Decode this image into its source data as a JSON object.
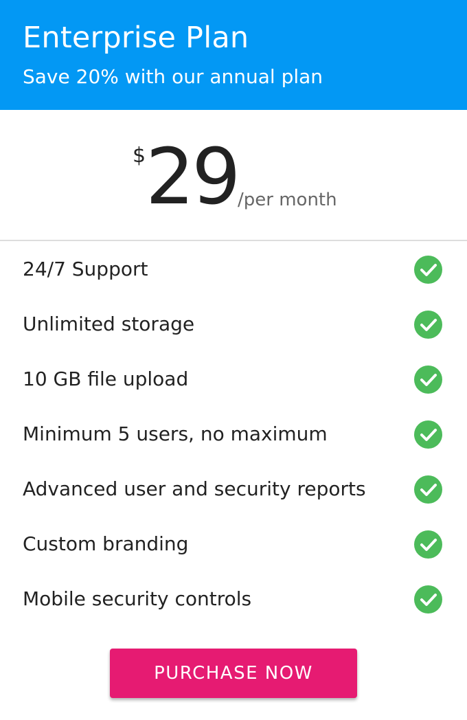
{
  "plan": {
    "title": "Enterprise Plan",
    "subtitle": "Save 20% with our annual plan",
    "header_color": "#0398f4"
  },
  "price": {
    "currency": "$",
    "amount": "29",
    "period": "/per month"
  },
  "features": [
    {
      "label": "24/7 Support",
      "included": true,
      "icon": "check-circle-icon"
    },
    {
      "label": "Unlimited storage",
      "included": true,
      "icon": "check-circle-icon"
    },
    {
      "label": "10 GB file upload",
      "included": true,
      "icon": "check-circle-icon"
    },
    {
      "label": "Minimum 5 users, no maximum",
      "included": true,
      "icon": "check-circle-icon"
    },
    {
      "label": "Advanced user and security reports",
      "included": true,
      "icon": "check-circle-icon"
    },
    {
      "label": "Custom branding",
      "included": true,
      "icon": "check-circle-icon"
    },
    {
      "label": "Mobile security controls",
      "included": true,
      "icon": "check-circle-icon"
    }
  ],
  "colors": {
    "check": "#4cbb5a",
    "cta": "#e61b72"
  },
  "cta": {
    "label": "PURCHASE NOW"
  }
}
